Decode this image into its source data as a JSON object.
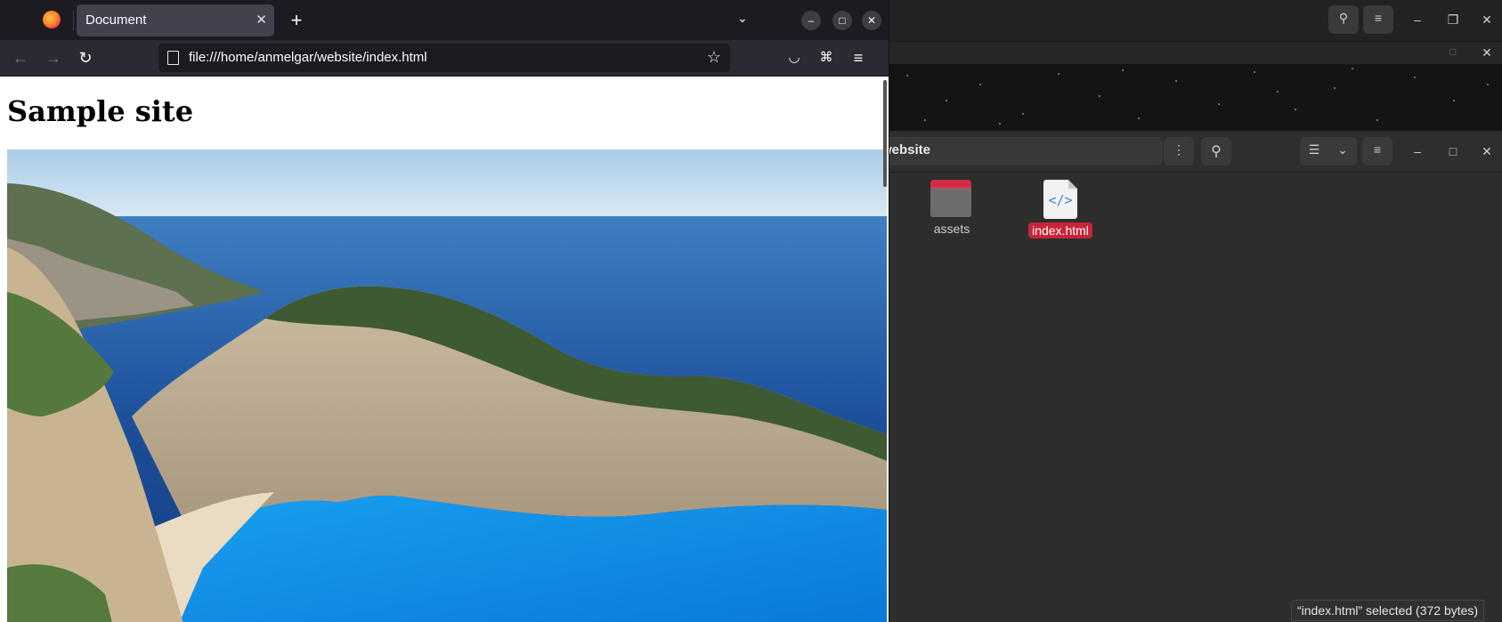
{
  "browser": {
    "tab_title": "Document",
    "tab_close": "✕",
    "new_tab": "+",
    "tab_list": "⌄",
    "window_minimize": "–",
    "window_maximize": "□",
    "window_close": "✕",
    "back": "←",
    "forward": "→",
    "reload": "↻",
    "url": "file:///home/anmelgar/website/index.html",
    "bookmark": "☆",
    "pocket": "◡",
    "extensions": "⌘",
    "menu": "≡"
  },
  "page": {
    "heading": "Sample site",
    "image_alt": "Coastal cliffs and turquoise bay"
  },
  "file_manager": {
    "path_label": "website",
    "menu_dots": "⋮",
    "search": "⚲",
    "view_list": "☰",
    "view_dropdown": "⌄",
    "main_menu": "≡",
    "minimize": "–",
    "maximize": "□",
    "close": "✕",
    "items": [
      {
        "name": "assets",
        "type": "folder",
        "selected": false
      },
      {
        "name": "index.html",
        "type": "html",
        "selected": true
      }
    ],
    "status": "“index.html” selected  (372 bytes)"
  },
  "background_window": {
    "search": "⚲",
    "menu": "≡",
    "minimize": "–",
    "restore": "❐",
    "close": "✕",
    "small_restore": "□",
    "small_close": "✕"
  },
  "colors": {
    "accent": "#c7243a",
    "browser_chrome": "#2b2a33",
    "tabbar": "#1c1b22",
    "file_manager_bg": "#2d2d2d"
  }
}
